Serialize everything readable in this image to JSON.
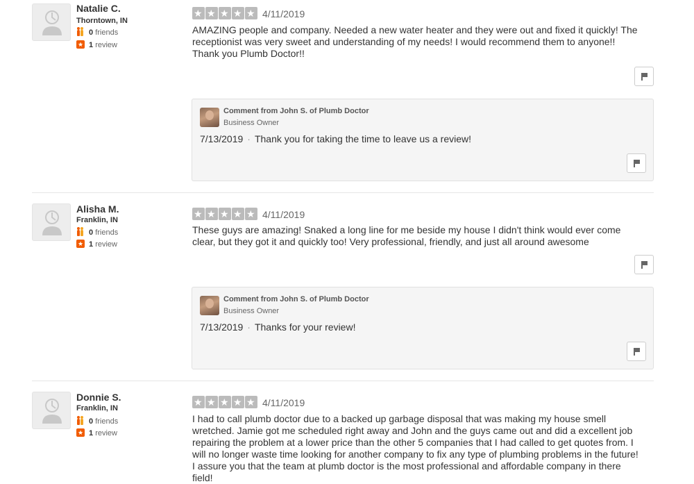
{
  "reviews": [
    {
      "user": {
        "name": "Natalie C.",
        "location": "Thorntown, IN",
        "friends_count": "0",
        "friends_label": "friends",
        "reviews_count": "1",
        "reviews_label": "review"
      },
      "rating": 5,
      "date": "4/11/2019",
      "text": "AMAZING people and company. Needed a new water heater and they were out and fixed it quickly! The receptionist was very sweet and understanding of my needs! I would recommend them to anyone!! Thank you Plumb Doctor!!",
      "comment": {
        "from": "Comment from John S. of Plumb Doctor",
        "role": "Business Owner",
        "date": "7/13/2019",
        "separator": "·",
        "text": "Thank you for taking the time to leave us a review!"
      }
    },
    {
      "user": {
        "name": "Alisha M.",
        "location": "Franklin, IN",
        "friends_count": "0",
        "friends_label": "friends",
        "reviews_count": "1",
        "reviews_label": "review"
      },
      "rating": 5,
      "date": "4/11/2019",
      "text": "These guys are amazing! Snaked a long line for me beside my house I didn't think would ever come clear, but they got it and quickly too! Very professional, friendly, and just all around awesome",
      "comment": {
        "from": "Comment from John S. of Plumb Doctor",
        "role": "Business Owner",
        "date": "7/13/2019",
        "separator": "·",
        "text": "Thanks for your review!"
      }
    },
    {
      "user": {
        "name": "Donnie S.",
        "location": "Franklin, IN",
        "friends_count": "0",
        "friends_label": "friends",
        "reviews_count": "1",
        "reviews_label": "review"
      },
      "rating": 5,
      "date": "4/11/2019",
      "text": "I had to call plumb doctor due to a backed up garbage disposal that was making my house smell wretched. Jamie got me scheduled right away and John and the guys came out and did a excellent job repairing the problem at a lower price than the other 5 companies that I had called to get quotes from. I will no longer waste time looking for another company to fix any type of plumbing problems in the future! I assure you that the team at plumb doctor is the most professional and affordable company in there field!"
    }
  ],
  "icons": {
    "avatar": "default-user-icon",
    "friends": "friends-icon",
    "review_count": "review-star-icon",
    "star": "star-icon",
    "flag": "flag-icon"
  },
  "colors": {
    "accent": "#f15c00",
    "star_inactive": "#bbbbbb",
    "comment_bg": "#f5f5f5"
  }
}
